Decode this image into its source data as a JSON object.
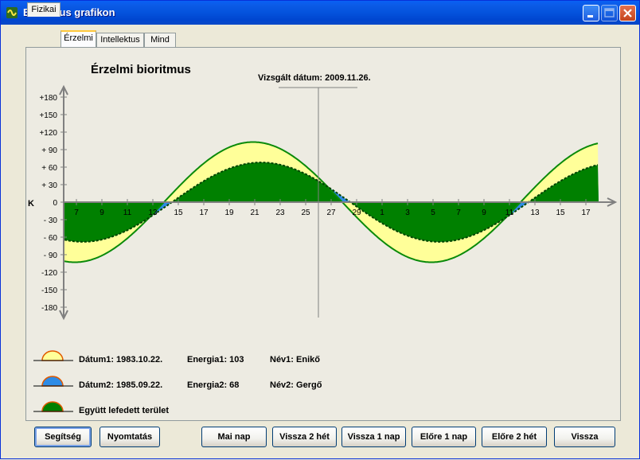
{
  "window": {
    "title": "Bioritmus grafikon"
  },
  "tabs": [
    {
      "label": "Fizikai"
    },
    {
      "label": "Érzelmi"
    },
    {
      "label": "Intellektus"
    },
    {
      "label": "Mind"
    }
  ],
  "active_tab": "Érzelmi",
  "chart": {
    "title": "Érzelmi bioritmus",
    "tested_date_label": "Vizsgált dátum: 2009.11.26.",
    "y_axis_letter": "K"
  },
  "chart_data": {
    "type": "area",
    "title": "Érzelmi bioritmus",
    "y_ticks": [
      "+180",
      "+150",
      "+120",
      "+ 90",
      "+ 60",
      "+ 30",
      "0",
      "- 30",
      "- 60",
      "- 90",
      "-120",
      "-150",
      "-180"
    ],
    "x_ticks": [
      "7",
      "9",
      "11",
      "13",
      "15",
      "17",
      "19",
      "21",
      "23",
      "25",
      "27",
      "29",
      "1",
      "3",
      "5",
      "7",
      "9",
      "11",
      "13",
      "15",
      "17"
    ],
    "ylim": [
      -180,
      180
    ],
    "series": [
      {
        "name": "Enikő",
        "period_days": 28,
        "amplitude": 103,
        "color": "#FFFF99"
      },
      {
        "name": "Gergő",
        "period_days": 28,
        "amplitude": 68,
        "color": "#1E90FF"
      }
    ],
    "overlap_color": "#008000"
  },
  "legend": [
    {
      "date": "Dátum1: 1983.10.22.",
      "energy": "Energia1: 103",
      "name": "Név1: Enikő",
      "color": "#FFFF99"
    },
    {
      "date": "Dátum2: 1985.09.22.",
      "energy": "Energia2: 68",
      "name": "Név2: Gergő",
      "color": "#1E90FF"
    },
    {
      "date": "Együtt lefedett terület",
      "color": "#008000"
    }
  ],
  "buttons": {
    "help": "Segítség",
    "print": "Nyomtatás",
    "today": "Mai nap",
    "back2w": "Vissza 2 hét",
    "back1d": "Vissza 1 nap",
    "fwd1d": "Előre 1 nap",
    "fwd2w": "Előre 2 hét",
    "back": "Vissza"
  }
}
